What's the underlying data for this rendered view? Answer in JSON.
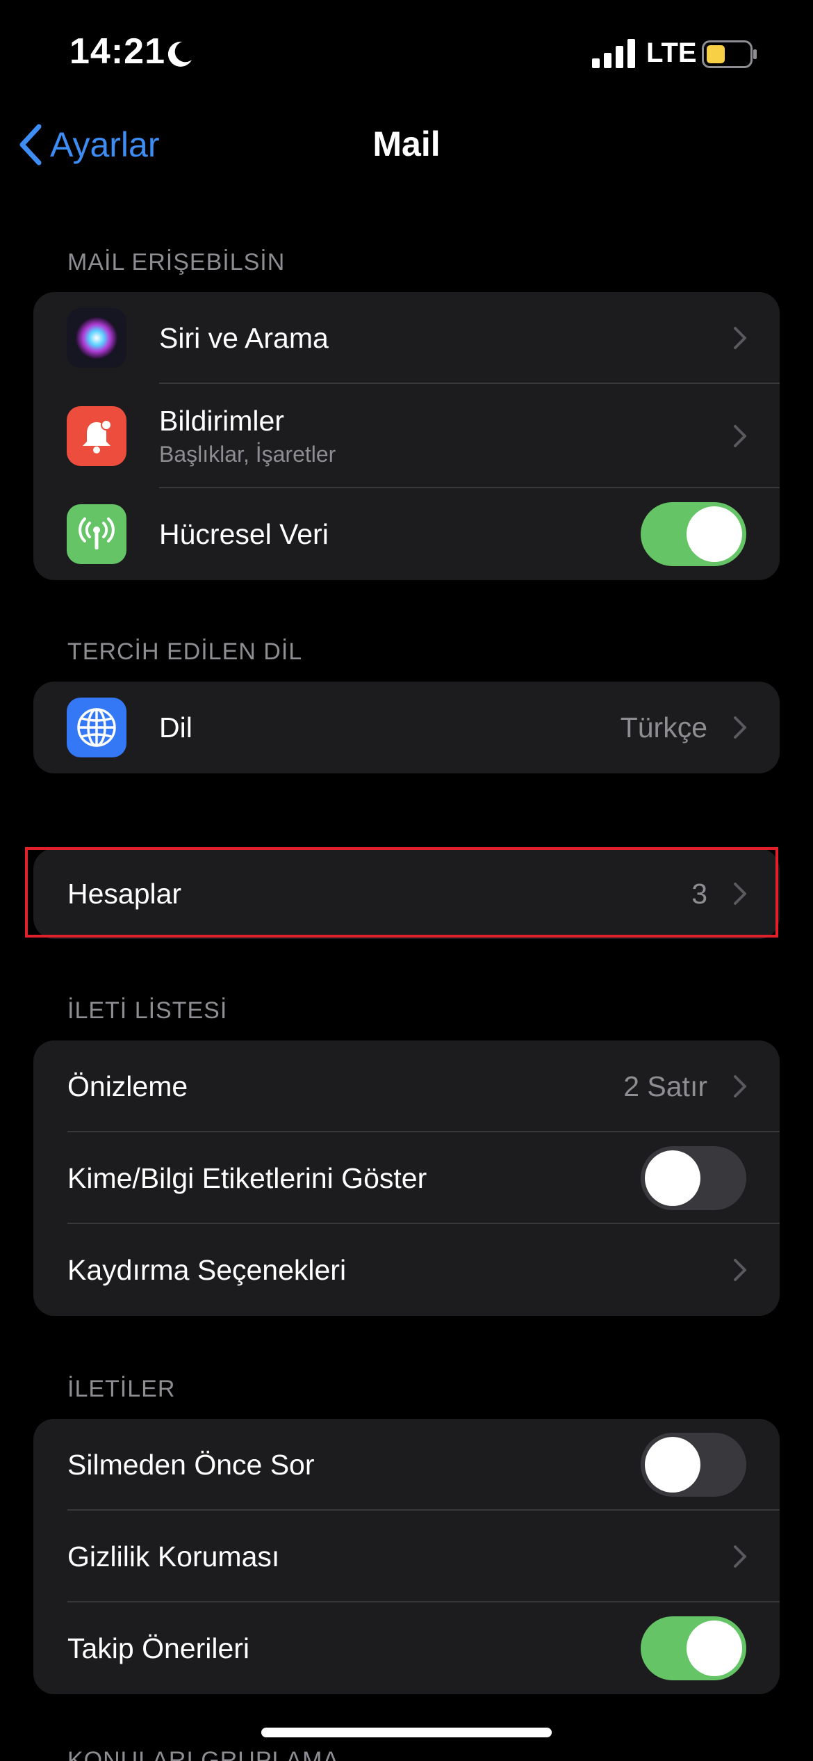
{
  "status_bar": {
    "time": "14:21",
    "network": "LTE",
    "battery_color": "#f7d046"
  },
  "nav": {
    "back_label": "Ayarlar",
    "title": "Mail"
  },
  "sections": {
    "access": {
      "header": "MAİL ERİŞEBİLSİN",
      "siri": {
        "label": "Siri ve Arama",
        "icon": "siri-icon"
      },
      "notifications": {
        "label": "Bildirimler",
        "sublabel": "Başlıklar, İşaretler",
        "icon": "bell-icon"
      },
      "cellular": {
        "label": "Hücresel Veri",
        "icon": "antenna-icon",
        "enabled": true
      }
    },
    "language": {
      "header": "TERCİH EDİLEN DİL",
      "language": {
        "label": "Dil",
        "value": "Türkçe",
        "icon": "globe-icon"
      }
    },
    "accounts": {
      "label": "Hesaplar",
      "value": "3"
    },
    "message_list": {
      "header": "İLETİ LİSTESİ",
      "preview": {
        "label": "Önizleme",
        "value": "2 Satır"
      },
      "show_to_cc": {
        "label": "Kime/Bilgi Etiketlerini Göster",
        "enabled": false
      },
      "swipe": {
        "label": "Kaydırma Seçenekleri"
      }
    },
    "messages": {
      "header": "İLETİLER",
      "ask_before_delete": {
        "label": "Silmeden Önce Sor",
        "enabled": false
      },
      "privacy": {
        "label": "Gizlilik Koruması"
      },
      "follow_up": {
        "label": "Takip Önerileri",
        "enabled": true
      }
    },
    "next": {
      "header": "KONULARI GRUPLAMA"
    }
  },
  "colors": {
    "accent": "#3d8df5",
    "toggle_on": "#65c466",
    "toggle_off": "#39393d",
    "highlight": "#e0202a"
  }
}
